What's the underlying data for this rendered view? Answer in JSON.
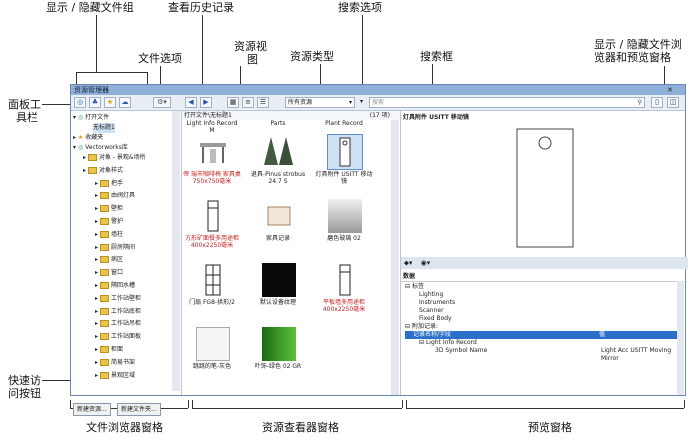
{
  "callouts": {
    "show_hide_groups": "显示 / 隐藏文件组",
    "history": "查看历史记录",
    "search_options": "搜索选项",
    "file_options": "文件选项",
    "resource_view": "资源视",
    "resource_view2": "图",
    "resource_type": "资源类型",
    "search_box": "搜索框",
    "show_hide_browser": "显示 / 隐藏文件浏",
    "show_hide_browser2": "览器和预览窗格",
    "panel_toolbar": "面板工",
    "panel_toolbar2": "具栏",
    "quick_access": "快速访",
    "quick_access2": "问按钮",
    "file_browser_pane": "文件浏览器窗格",
    "resource_viewer_pane": "资源查看器窗格",
    "preview_pane": "预览窗格"
  },
  "window": {
    "title": "资源管理器"
  },
  "toolbar": {
    "resource_type_value": "所有资源",
    "search_placeholder": "搜索"
  },
  "tree": {
    "open_files": "打开文件",
    "untitled": "无标题1",
    "favorites": "收藏夹",
    "library": "Vectorworks库",
    "items": [
      "对象 - 景观&场所",
      "对象样式",
      "把手",
      "由阀灯具",
      "壁柜",
      "警护",
      "墙柱",
      "厨房隔间",
      "病区",
      "窗口",
      "隔回水槽",
      "工作站壁柜",
      "工作站底柜",
      "工作站吊柜",
      "工作站面板",
      "柜面",
      "简易书架",
      "景观区域"
    ]
  },
  "quick_buttons": [
    "新建资源...",
    "新建文件夹..."
  ],
  "viewer": {
    "header": "打开文件\\无标题1",
    "count": "(17 项)",
    "top_labels": [
      "Light Info Record",
      "Parts",
      "Plant Record"
    ],
    "top_m": "M",
    "items": [
      {
        "label": "帝 瑞市咖啡椅 家具桌 750x750毫米",
        "red": true
      },
      {
        "label": "退具-Pinus strobus 24.7 S",
        "red": false
      },
      {
        "label": "灯具附件 USITT 移动镜",
        "red": false
      },
      {
        "label": "方形矿面餐多用途柜 400x2250毫米",
        "red": true
      },
      {
        "label": "家具记录",
        "red": false
      },
      {
        "label": "磨色玻璃 02",
        "red": false
      },
      {
        "label": "门扇 FG8-拱形/2",
        "red": false
      },
      {
        "label": "默认设备纹理",
        "red": false
      },
      {
        "label": "平板墙多用途柜 400x2250毫米",
        "red": true
      },
      {
        "label": "跳跳的笔-灰色",
        "red": false
      },
      {
        "label": "叶饰-绿色 02 GR",
        "red": false
      }
    ]
  },
  "preview": {
    "title": "灯具附件 USITT 移动镜",
    "data_header": "数据",
    "lines": [
      "标签",
      "Lighting",
      "Instruments",
      "Scanner",
      "Fixed Body",
      "附加记录:",
      "记录名称/字段",
      "值",
      "Light Info Record",
      "3D Symbol Name",
      "Light Acc USITT Moving Mirror"
    ]
  }
}
